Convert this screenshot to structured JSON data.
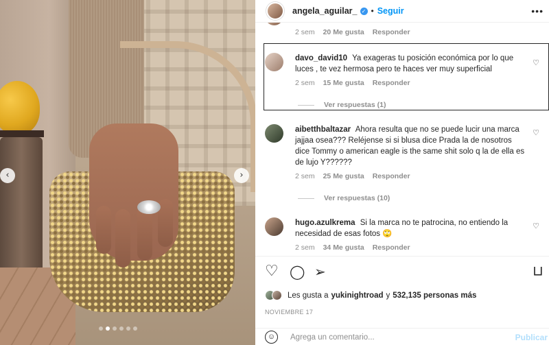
{
  "post": {
    "username": "angela_aguilar_",
    "separator": "•",
    "follow_label": "Seguir",
    "more_icon": "•••",
    "verified_icon": "✓"
  },
  "carousel": {
    "prev_icon": "‹",
    "next_icon": "›",
    "dots_total": 6,
    "dots_active_index": 1
  },
  "comments": {
    "top_meta": {
      "time": "2 sem",
      "likes": "20 Me gusta",
      "reply": "Responder"
    },
    "items": [
      {
        "user": "davo_david10",
        "text": "Ya exageras tu posición económica por lo que luces , te vez hermosa pero te haces ver muy superficial",
        "time": "2 sem",
        "likes": "15 Me gusta",
        "reply": "Responder",
        "replies_label": "Ver respuestas (1)"
      },
      {
        "user": "aibetthbaltazar",
        "text": "Ahora resulta que no se puede lucir una marca jajjaa osea??? Reléjense si si blusa dice Prada la de nosotros dice Tommy o american eagle is the same shit solo q la de ella es de lujo Y??????",
        "time": "2 sem",
        "likes": "25 Me gusta",
        "reply": "Responder",
        "replies_label": "Ver respuestas (10)"
      },
      {
        "user": "hugo.azulkrema",
        "text": "Si la marca no te patrocina, no entiendo la necesidad de esas fotos 🙄",
        "time": "2 sem",
        "likes": "34 Me gusta",
        "reply": "Responder"
      }
    ]
  },
  "actions": {
    "like_icon": "♡",
    "comment_icon": "◯",
    "share_icon": "➢",
    "save_icon": "⊓",
    "likes_prefix": "Les gusta a",
    "likes_user": "yukinightroad",
    "likes_connector": "y",
    "likes_count": "532,135 personas más",
    "date": "NOVIEMBRE 17"
  },
  "composer": {
    "emoji_icon": "☺",
    "placeholder": "Agrega un comentario...",
    "publish_label": "Publicar"
  }
}
